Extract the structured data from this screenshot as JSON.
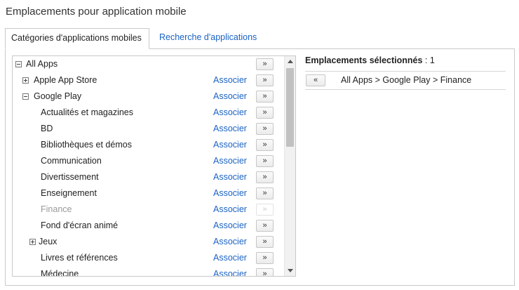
{
  "page": {
    "title": "Emplacements pour application mobile"
  },
  "tabs": [
    {
      "label": "Catégories d'applications mobiles",
      "active": true
    },
    {
      "label": "Recherche d'applications",
      "active": false
    }
  ],
  "tree": {
    "associate_label": "Associer",
    "add_button_label": "»",
    "rows": [
      {
        "label": "All Apps",
        "toggle": "minus",
        "level": 0,
        "has_associate": false,
        "disabled": false
      },
      {
        "label": "Apple App Store",
        "toggle": "plus",
        "level": 1,
        "has_associate": true,
        "disabled": false
      },
      {
        "label": "Google Play",
        "toggle": "minus",
        "level": 1,
        "has_associate": true,
        "disabled": false
      },
      {
        "label": "Actualités et magazines",
        "toggle": null,
        "level": 2,
        "has_associate": true,
        "disabled": false
      },
      {
        "label": "BD",
        "toggle": null,
        "level": 2,
        "has_associate": true,
        "disabled": false
      },
      {
        "label": "Bibliothèques et démos",
        "toggle": null,
        "level": 2,
        "has_associate": true,
        "disabled": false
      },
      {
        "label": "Communication",
        "toggle": null,
        "level": 2,
        "has_associate": true,
        "disabled": false
      },
      {
        "label": "Divertissement",
        "toggle": null,
        "level": 2,
        "has_associate": true,
        "disabled": false
      },
      {
        "label": "Enseignement",
        "toggle": null,
        "level": 2,
        "has_associate": true,
        "disabled": false
      },
      {
        "label": "Finance",
        "toggle": null,
        "level": 2,
        "has_associate": true,
        "disabled": true
      },
      {
        "label": "Fond d'écran animé",
        "toggle": null,
        "level": 2,
        "has_associate": true,
        "disabled": false
      },
      {
        "label": "Jeux",
        "toggle": "plus",
        "level": 2,
        "has_associate": true,
        "disabled": false
      },
      {
        "label": "Livres et références",
        "toggle": null,
        "level": 2,
        "has_associate": true,
        "disabled": false
      },
      {
        "label": "Médecine",
        "toggle": null,
        "level": 2,
        "has_associate": true,
        "disabled": false
      }
    ]
  },
  "selected": {
    "header_label": "Emplacements sélectionnés",
    "header_sep": " : ",
    "count": "1",
    "remove_button_label": "«",
    "items": [
      {
        "path": "All Apps > Google Play > Finance"
      }
    ]
  }
}
